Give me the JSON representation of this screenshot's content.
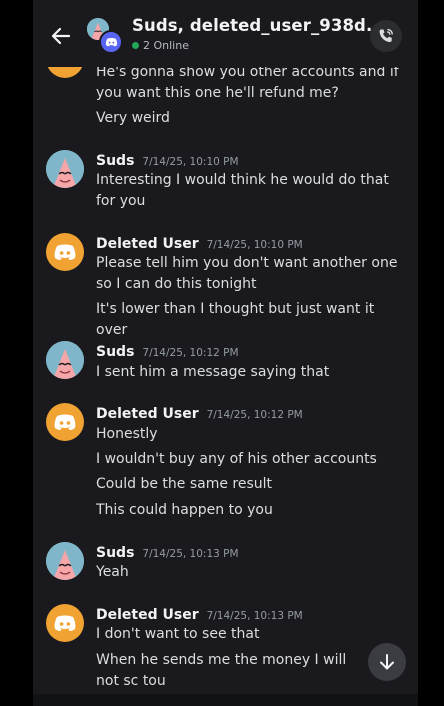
{
  "header": {
    "channel_title": "Suds, deleted_user_938d...",
    "online_count": "2 Online",
    "chevron": "›"
  },
  "icons": {
    "back": "arrow-left-icon",
    "call": "phone-call-icon",
    "jump": "arrow-down-icon",
    "discord": "discord-logo-icon"
  },
  "colors": {
    "app_bg": "#1a1a1e",
    "discord_avatar": "#f0a232",
    "online": "#23a55a",
    "group_badge": "#5865f2"
  },
  "messages": [
    {
      "lines": [
        "He's gonna show you other accounts and if you want this one he'll refund me?",
        "Very weird"
      ]
    },
    {
      "author": "Suds",
      "timestamp": "7/14/25, 10:10 PM",
      "lines": [
        "Interesting I would think he would do that for you"
      ]
    },
    {
      "author": "Deleted User",
      "timestamp": "7/14/25, 10:10 PM",
      "lines": [
        "Please tell him you don't want another one so I can do this tonight",
        "It's lower than I thought but just want it over"
      ]
    },
    {
      "author": "Suds",
      "timestamp": "7/14/25, 10:12 PM",
      "lines": [
        "I sent him a message saying that"
      ]
    },
    {
      "author": "Deleted User",
      "timestamp": "7/14/25, 10:12 PM",
      "lines": [
        "Honestly",
        "I wouldn't buy any of his other accounts",
        "Could be the same result",
        "This could happen to you"
      ]
    },
    {
      "author": "Suds",
      "timestamp": "7/14/25, 10:13 PM",
      "lines": [
        "Yeah"
      ]
    },
    {
      "author": "Deleted User",
      "timestamp": "7/14/25, 10:13 PM",
      "lines": [
        "I don't want to see that",
        "When he sends me the money I will not sc tou"
      ]
    }
  ]
}
